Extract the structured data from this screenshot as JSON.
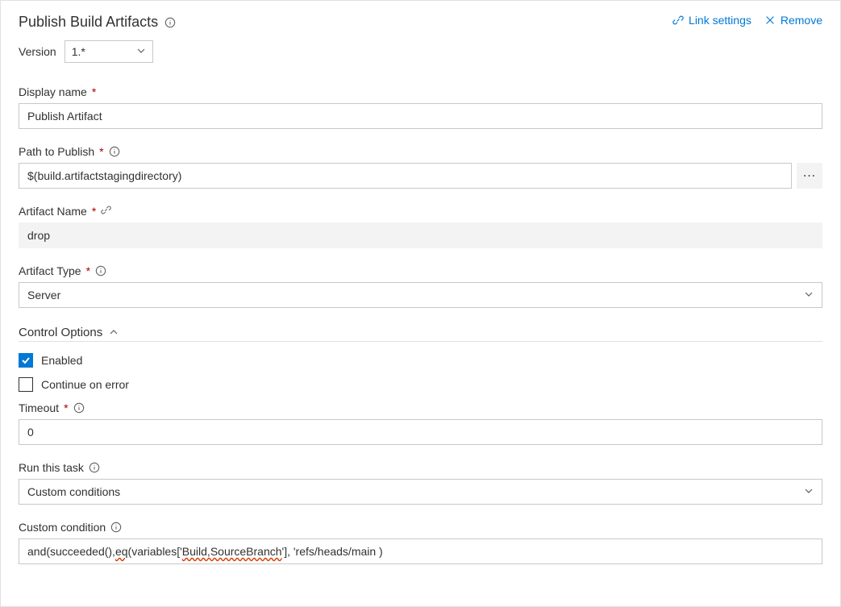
{
  "header": {
    "title": "Publish Build Artifacts",
    "linkSettings": "Link settings",
    "remove": "Remove"
  },
  "version": {
    "label": "Version",
    "value": "1.*"
  },
  "fields": {
    "displayName": {
      "label": "Display name",
      "value": "Publish Artifact"
    },
    "pathToPublish": {
      "label": "Path to Publish",
      "value": "$(build.artifactstagingdirectory)"
    },
    "artifactName": {
      "label": "Artifact Name",
      "value": "drop"
    },
    "artifactType": {
      "label": "Artifact Type",
      "value": "Server"
    }
  },
  "controlOptions": {
    "title": "Control Options",
    "enabled": {
      "label": "Enabled",
      "checked": true
    },
    "continueOnError": {
      "label": "Continue on error",
      "checked": false
    },
    "timeout": {
      "label": "Timeout",
      "value": "0"
    },
    "runThisTask": {
      "label": "Run this task",
      "value": "Custom conditions"
    },
    "customCondition": {
      "label": "Custom condition",
      "prefix": "and(succeeded(), ",
      "spell1": "eq",
      "mid1": "(variables['",
      "spell2": "Build,SourceBranch",
      "suffix": "'], 'refs/heads/main )"
    }
  }
}
